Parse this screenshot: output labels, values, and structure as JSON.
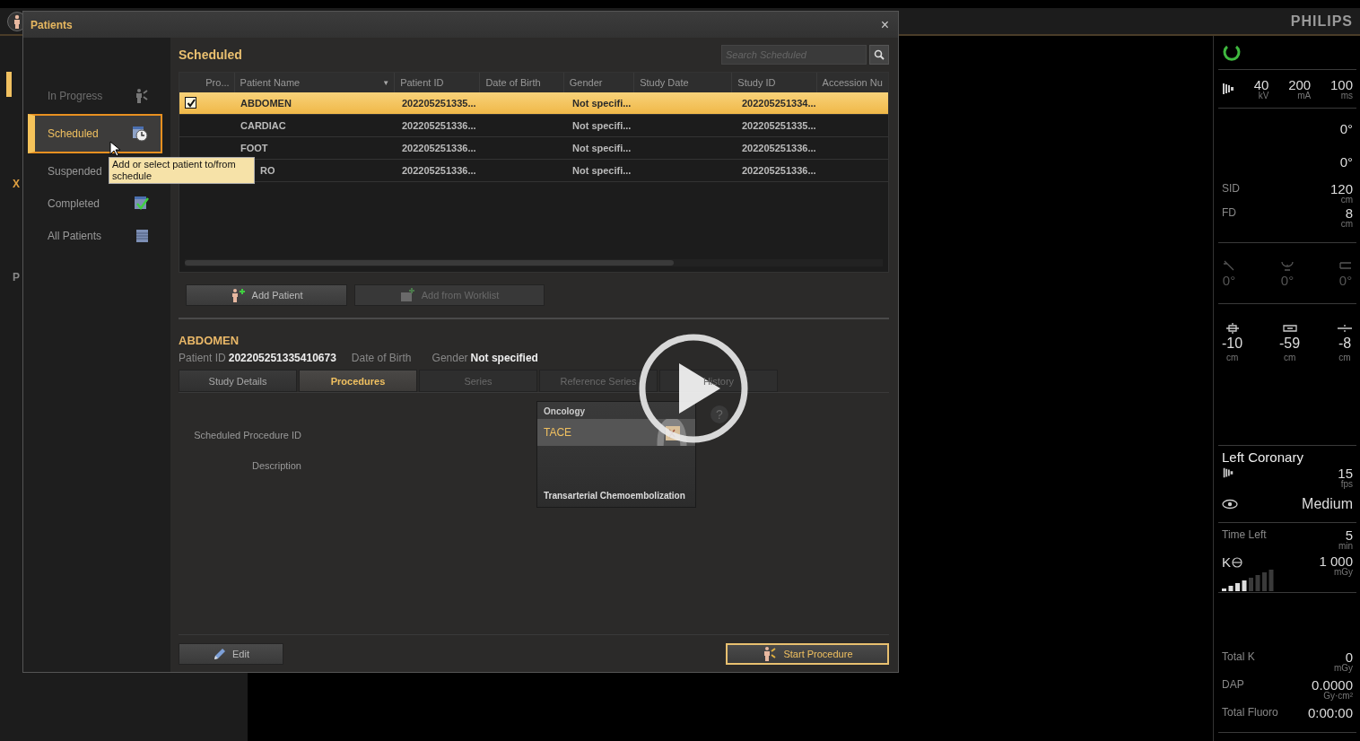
{
  "top_bar": {
    "brand": "PHILIPS"
  },
  "background_app": {
    "labels": [
      "X",
      "P"
    ]
  },
  "window": {
    "title": "Patients",
    "close": "×"
  },
  "sidebar": {
    "items": [
      {
        "label": "In Progress",
        "selected": false,
        "disabled": true
      },
      {
        "label": "Scheduled",
        "selected": true,
        "disabled": false
      },
      {
        "label": "Suspended",
        "selected": false,
        "disabled": false
      },
      {
        "label": "Completed",
        "selected": false,
        "disabled": false
      },
      {
        "label": "All Patients",
        "selected": false,
        "disabled": false
      }
    ]
  },
  "tooltip": "Add or select patient to/from schedule",
  "list": {
    "title": "Scheduled",
    "search": {
      "placeholder": "Search Scheduled"
    },
    "columns": [
      {
        "label": "Pro..."
      },
      {
        "label": "Patient Name",
        "sort_mark": "▼"
      },
      {
        "label": "Patient ID"
      },
      {
        "label": "Date of Birth"
      },
      {
        "label": "Gender"
      },
      {
        "label": "Study Date"
      },
      {
        "label": "Study ID"
      },
      {
        "label": "Accession Nu"
      }
    ],
    "rows": [
      {
        "selected": true,
        "checked": true,
        "covered": false,
        "name": "ABDOMEN",
        "patient_id": "202205251335...",
        "gender": "Not specifi...",
        "study_id": "202205251334..."
      },
      {
        "selected": false,
        "checked": false,
        "covered": false,
        "name": "CARDIAC",
        "patient_id": "202205251336...",
        "gender": "Not specifi...",
        "study_id": "202205251335..."
      },
      {
        "selected": false,
        "checked": false,
        "covered": false,
        "name": "FOOT",
        "patient_id": "202205251336...",
        "gender": "Not specifi...",
        "study_id": "202205251336..."
      },
      {
        "selected": false,
        "checked": false,
        "covered": true,
        "name": "RO",
        "patient_id": "202205251336...",
        "gender": "Not specifi...",
        "study_id": "202205251336..."
      }
    ],
    "buttons": [
      {
        "label": "Add Patient",
        "kind": "add",
        "disabled": false
      },
      {
        "label": "Add from Worklist",
        "kind": "worklist",
        "disabled": true
      }
    ]
  },
  "details": {
    "title": "ABDOMEN",
    "info": [
      {
        "label": "Patient ID",
        "value": "202205251335410673"
      },
      {
        "label": "Date of Birth"
      },
      {
        "label": "Gender",
        "value": "Not specified"
      }
    ],
    "tabs": [
      {
        "label": "Study Details",
        "selected": false,
        "disabled": false
      },
      {
        "label": "Procedures",
        "selected": true,
        "disabled": false
      },
      {
        "label": "Series",
        "selected": false,
        "disabled": true
      },
      {
        "label": "Reference Series",
        "selected": false,
        "disabled": true
      },
      {
        "label": "History",
        "selected": false,
        "disabled": true
      }
    ],
    "fields": [
      "Scheduled Procedure ID",
      "Description"
    ],
    "procedure": {
      "group": "Oncology",
      "name": "TACE",
      "description": "Transarterial Chemoembolization"
    },
    "help": "?",
    "buttons": [
      {
        "label": "Edit",
        "kind": "edit"
      },
      {
        "label": "Start Procedure",
        "kind": "start"
      }
    ]
  },
  "panel": {
    "exposure": [
      {
        "value": "40",
        "unit": "kV"
      },
      {
        "value": "200",
        "unit": "mA"
      },
      {
        "value": "100",
        "unit": "ms"
      }
    ],
    "angles": [
      "0°",
      "0°"
    ],
    "distances": [
      {
        "label": "SID",
        "value": "120",
        "unit": "cm"
      },
      {
        "label": "FD",
        "value": "8",
        "unit": "cm"
      }
    ],
    "rotations": [
      "0°",
      "0°",
      "0°"
    ],
    "positions": [
      {
        "value": "-10",
        "unit": "cm"
      },
      {
        "value": "-59",
        "unit": "cm"
      },
      {
        "value": "-8",
        "unit": "cm"
      }
    ],
    "protocol": {
      "name": "Left Coronary",
      "rate": "15",
      "rate_unit": "fps",
      "dose": "Medium"
    },
    "time_left": {
      "label": "Time Left",
      "value": "5",
      "unit": "min"
    },
    "kerma": {
      "label": "K",
      "value": "1 000",
      "unit": "mGy"
    },
    "totals": [
      {
        "label": "Total K",
        "value": "0",
        "unit": "mGy"
      },
      {
        "label": "DAP",
        "value": "0.0000",
        "unit": "Gy·cm²"
      },
      {
        "label": "Total Fluoro",
        "value": "0:00:00"
      }
    ]
  }
}
